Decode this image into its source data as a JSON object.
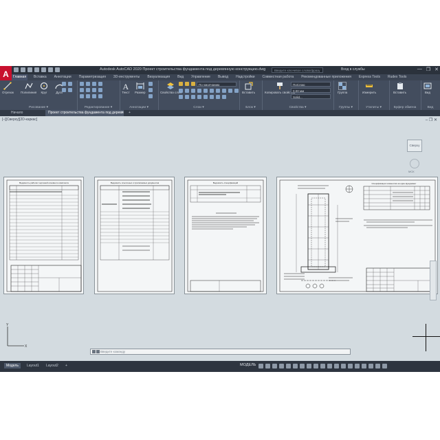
{
  "app": {
    "logo": "A",
    "title": "Autodesk AutoCAD 2020   Проект строительства фундамента под деревянную конструкцию.dwg",
    "search_placeholder": "Введите ключевое слово/фразу",
    "signin": "Вход в службы",
    "window_controls": [
      "—",
      "❐",
      "✕"
    ]
  },
  "ribbon_tabs": [
    "Главная",
    "Вставка",
    "Аннотации",
    "Параметризация",
    "3D-инструменты",
    "Визуализация",
    "Вид",
    "Управление",
    "Вывод",
    "Надстройки",
    "Совместная работа",
    "Рекомендованные приложения",
    "Express Tools",
    "Rudex Tools"
  ],
  "active_ribbon_tab": "Главная",
  "panels": {
    "draw": {
      "label": "Рисование ▾",
      "tools": [
        "Отрезок",
        "Полилиния",
        "Круг",
        "Дуга"
      ]
    },
    "modify": {
      "label": "Редактирование ▾"
    },
    "annotation": {
      "label": "Аннотации ▾",
      "tools": [
        "Текст",
        "Размер"
      ]
    },
    "layers": {
      "label": "Слои ▾",
      "tools": [
        "Свойства слоя"
      ],
      "layer_combo": "По умолчанию"
    },
    "block": {
      "label": "Блок ▾",
      "tools": [
        "Вставить"
      ]
    },
    "properties": {
      "label": "Свойства ▾",
      "tools": [
        "Копировать свойства"
      ],
      "color": "ПоСлою",
      "lineweight": "0.00 мм",
      "linetype": "Solid..."
    },
    "groups": {
      "label": "Группы ▾",
      "tools": [
        "Группа"
      ]
    },
    "utilities": {
      "label": "Утилиты ▾",
      "tools": [
        "Измерить"
      ]
    },
    "clipboard": {
      "label": "Буфер обмена",
      "tools": [
        "Вставить"
      ]
    },
    "view": {
      "label": "Вид",
      "tools": [
        "Вид"
      ]
    }
  },
  "doc_tabs": [
    "Начало",
    "Проект строительства фундамента под деревянную конструкцию",
    "+"
  ],
  "viewport": {
    "label": "[–][Сверху][2D-каркас]",
    "controls": "– ❐ ✕",
    "viewcube_label": "Сверху",
    "compass": "МСК"
  },
  "command_line": {
    "placeholder": "Введите команду"
  },
  "layout_tabs": [
    "Модель",
    "Layout1",
    "Layout2",
    "+"
  ],
  "status": {
    "model": "МОДЕЛЬ"
  },
  "sheets": {
    "sheet1": {
      "title": "Ведомость рабочих чертежей основного комплекта"
    },
    "sheet2": {
      "title": "Ведомость ссылочных и прилагаемых документов"
    },
    "sheet3": {
      "title": "Ведомость спецификаций"
    },
    "sheet4": {
      "title": "Спецификация элементов на один фундамент"
    }
  },
  "colors": {
    "app_bg": "#3b4453",
    "ribbon_bg": "#434d5e",
    "viewport_bg": "#d3dbe0",
    "logo_red": "#c8102e"
  }
}
